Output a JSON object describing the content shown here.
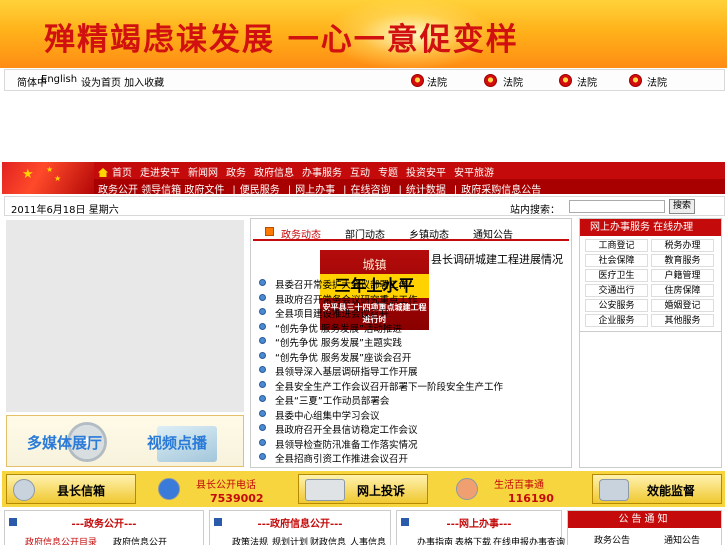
{
  "banner": {
    "title": "殚精竭虑谋发展 一心一意促变样"
  },
  "topbar": {
    "left_text": "简体中",
    "english": "English",
    "links_text": "设为首页 加入收藏",
    "emblem_links": [
      "法院",
      "法院",
      "法院",
      "法院"
    ]
  },
  "nav": {
    "row1": [
      "首页",
      "走进安平",
      "新闻网",
      "政务",
      "政府信息",
      "办事服务",
      "互动",
      "专题",
      "投资安平",
      "安平旅游"
    ],
    "row2": [
      "政务公开 领导信箱 政府文件",
      "便民服务",
      "网上办事",
      "在线咨询",
      "统计数据",
      "政府采购信息公告"
    ]
  },
  "datebar": {
    "date": "2011年6月18日 星期六",
    "search_label": "站内搜索：",
    "search_value": "",
    "search_button": "搜索"
  },
  "multimedia": {
    "label1": "多媒体展厅",
    "label2": "视频点播"
  },
  "center": {
    "tabs": [
      "政务动态",
      "部门动态",
      "乡镇动态",
      "通知公告"
    ],
    "image": {
      "line1": "城镇",
      "line2": "三年上水平",
      "line3": "安平县三十四项重点城建工程进行时"
    },
    "headline": "县长调研城建工程进展情况",
    "news": [
      "县委召开常委扩大会议部署工作",
      "县政府召开常务会议研究重点工作",
      "全县项目建设推进会议召开",
      "“创先争优 服务发展”活动推进",
      "“创先争优 服务发展”主题实践",
      "“创先争优 服务发展”座谈会召开",
      "县领导深入基层调研指导工作开展",
      "全县安全生产工作会议召开部署下一阶段安全生产工作",
      "全县“三夏”工作动员部署会",
      "县委中心组集中学习会议",
      "县政府召开全县信访稳定工作会议",
      "县领导检查防汛准备工作落实情况",
      "全县招商引资工作推进会议召开"
    ]
  },
  "rightpanel": {
    "title": "网上办事服务 在线办理",
    "cells": [
      "工商登记",
      "税务办理",
      "社会保障",
      "教育服务",
      "医疗卫生",
      "户籍管理",
      "交通出行",
      "住房保障",
      "公安服务",
      "婚姻登记",
      "企业服务",
      "其他服务"
    ]
  },
  "services": [
    {
      "label": "县长信箱"
    },
    {
      "label_top": "县长公开电话",
      "label_bottom": "7539002"
    },
    {
      "label": "网上投诉"
    },
    {
      "label_top": "生活百事通",
      "label_bottom": "116190"
    },
    {
      "label": "效能监督"
    }
  ],
  "bottom_boxes": [
    {
      "title": "---政务公开---",
      "subs": [
        "政府信息公开目录",
        "政府信息公开"
      ]
    },
    {
      "title": "---政府信息公开---",
      "subs": [
        "政策法规",
        "规划计划",
        "财政信息",
        "人事信息"
      ]
    },
    {
      "title": "---网上办事---",
      "subs": [
        "办事指南",
        "表格下载",
        "在线申报",
        "办事查询"
      ]
    }
  ],
  "right_bottom": {
    "title": "公告通知",
    "items": [
      "政务公告",
      "通知公告"
    ]
  }
}
